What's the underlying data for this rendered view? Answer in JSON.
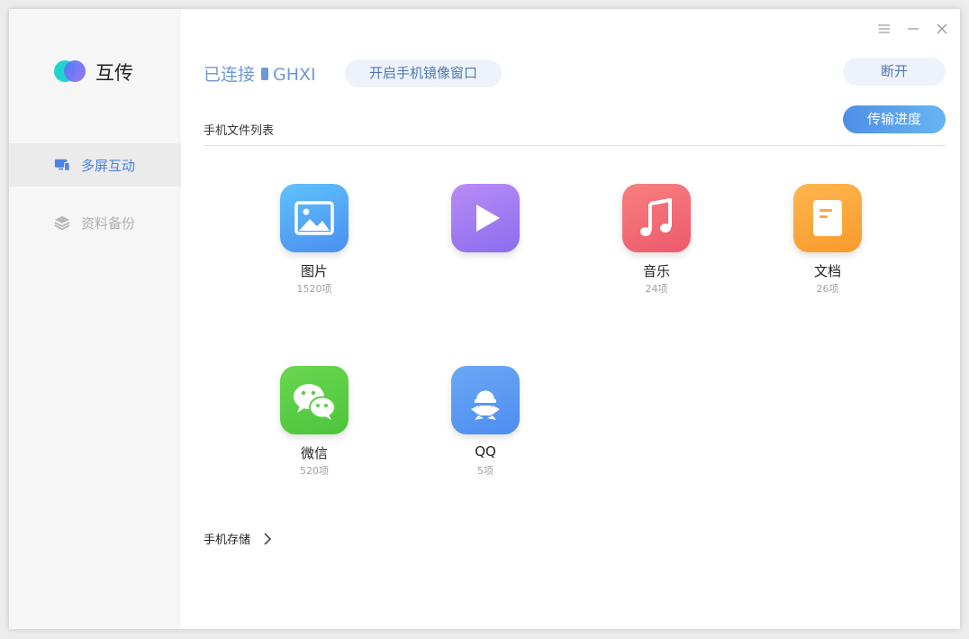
{
  "app": {
    "name": "互传"
  },
  "sidebar": {
    "items": [
      {
        "label": "多屏互动",
        "icon": "multi-screen-icon",
        "active": true
      },
      {
        "label": "资料备份",
        "icon": "layers-icon",
        "active": false
      }
    ]
  },
  "titlebar": {
    "icons": [
      "menu-icon",
      "minimize-icon",
      "close-icon"
    ]
  },
  "header": {
    "status": "已连接",
    "device": "GHXI",
    "mirror_label": "开启手机镜像窗口",
    "disconnect_label": "断开",
    "transfer_label": "传输进度"
  },
  "files": {
    "section_title": "手机文件列表",
    "categories": [
      {
        "name": "图片",
        "count": "1520项",
        "icon": "image-icon",
        "color": "#4aa4f5"
      },
      {
        "name": "",
        "count": "",
        "icon": "video-play-icon",
        "color": "#9b7af0"
      },
      {
        "name": "音乐",
        "count": "24项",
        "icon": "music-note-icon",
        "color": "#f06f78"
      },
      {
        "name": "文档",
        "count": "26项",
        "icon": "document-icon",
        "color": "#fba63a"
      },
      {
        "name": "微信",
        "count": "520项",
        "icon": "wechat-icon",
        "color": "#5ccc46"
      },
      {
        "name": "QQ",
        "count": "5项",
        "icon": "qq-icon",
        "color": "#5b9df2"
      }
    ]
  },
  "storage": {
    "label": "手机存储"
  },
  "colors": {
    "accent": "#4a83e8",
    "status_text": "#6d99d6"
  }
}
